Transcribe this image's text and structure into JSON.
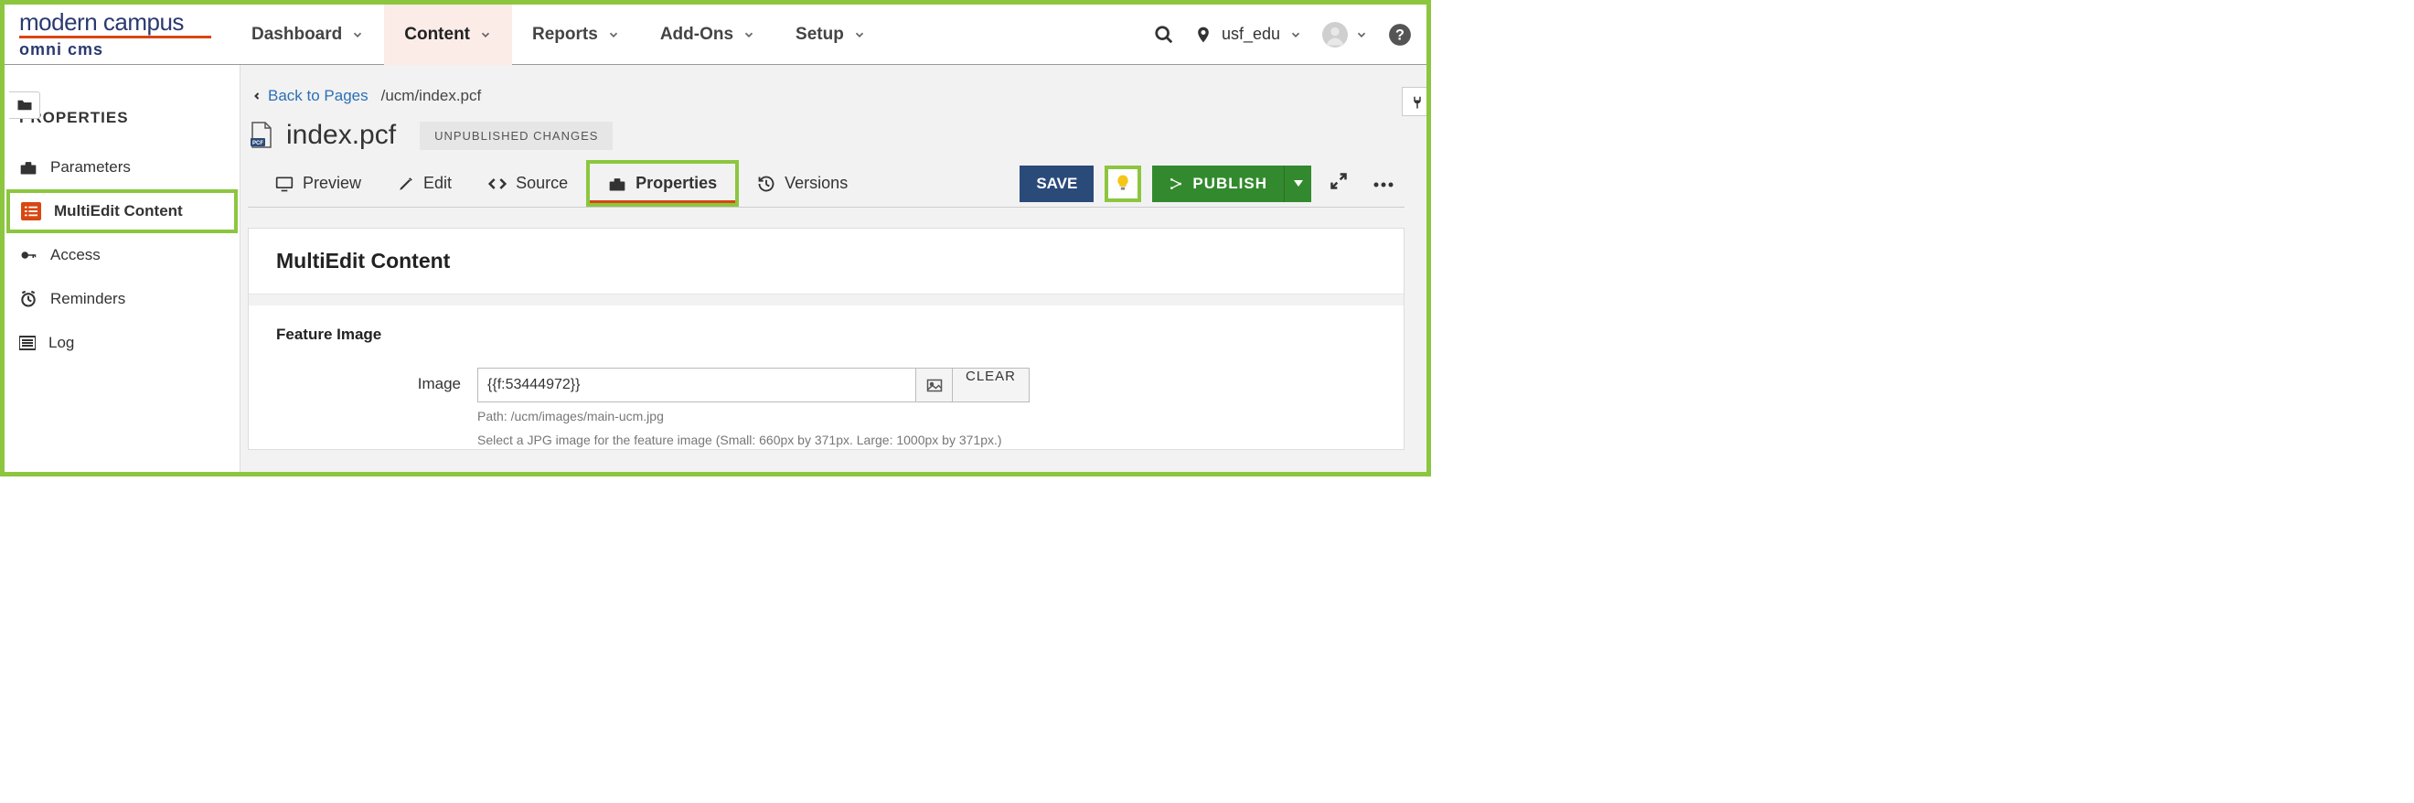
{
  "logo": {
    "top": "modern campus",
    "sub": "omni cms"
  },
  "nav": {
    "dashboard": "Dashboard",
    "content": "Content",
    "reports": "Reports",
    "addons": "Add-Ons",
    "setup": "Setup"
  },
  "topbar": {
    "site": "usf_edu"
  },
  "sidebar": {
    "heading": "PROPERTIES",
    "items": {
      "parameters": "Parameters",
      "multiedit": "MultiEdit Content",
      "access": "Access",
      "reminders": "Reminders",
      "log": "Log"
    }
  },
  "crumb": {
    "back": "Back to Pages",
    "path": "/ucm/index.pcf"
  },
  "page": {
    "title": "index.pcf",
    "status": "UNPUBLISHED CHANGES"
  },
  "tabs": {
    "preview": "Preview",
    "edit": "Edit",
    "source": "Source",
    "properties": "Properties",
    "versions": "Versions"
  },
  "actions": {
    "save": "SAVE",
    "publish": "PUBLISH"
  },
  "panel": {
    "title": "MultiEdit Content",
    "section": "Feature Image",
    "field_label": "Image",
    "image_value": "{{f:53444972}}",
    "clear": "CLEAR",
    "help1": "Path: /ucm/images/main-ucm.jpg",
    "help2": "Select a JPG image for the feature image (Small: 660px by 371px. Large: 1000px by 371px.)"
  }
}
